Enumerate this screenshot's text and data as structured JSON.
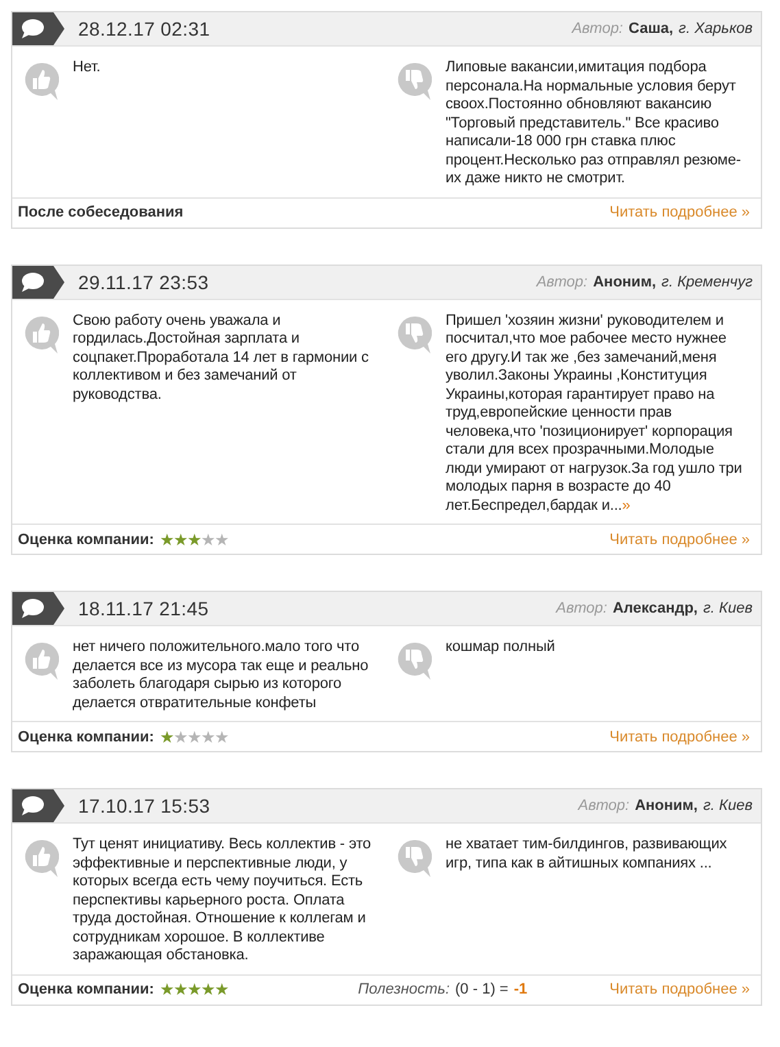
{
  "reviews": [
    {
      "date": "28.12.17 02:31",
      "author_label": "Автор:",
      "author_name": "Саша,",
      "author_city": "г. Харьков",
      "pros": {
        "text": "Нет."
      },
      "cons": {
        "text": "Липовые вакансии,имитация подбора персонала.На нормальные условия берут своох.Постоянно обновляют вакансию \"Торговый представитель.\" Все красиво написали-18 000 грн ставка плюс процент.Несколько раз отправлял резюме-их даже никто не смотрит."
      },
      "footer": {
        "kind": "note",
        "text": "После собеседования"
      },
      "read_more": "Читать подробнее »"
    },
    {
      "date": "29.11.17 23:53",
      "author_label": "Автор:",
      "author_name": "Аноним,",
      "author_city": "г. Кременчуг",
      "pros": {
        "text": "Свою работу очень уважала и гордилась.Достойная зарплата и соцпакет.Проработала 14 лет в гармонии с коллективом и без замечаний от руководства."
      },
      "cons": {
        "text": "Пришел 'хозяин жизни' руководителем и посчитал,что мое рабочее место нужнее его другу.И так же ,без замечаний,меня уволил.Законы Украины ,Конституция Украины,которая гарантирует право на труд,европейские ценности прав человека,что 'позиционирует' корпорация стали для всех прозрачными.Молодые люди умирают от нагрузок.За год ушло три молодых парня в возрасте до 40 лет.Беспредел,бардак и...",
        "more_link": "»"
      },
      "footer": {
        "kind": "rating",
        "text": "Оценка компании:",
        "stars": 3
      },
      "read_more": "Читать подробнее »"
    },
    {
      "date": "18.11.17 21:45",
      "author_label": "Автор:",
      "author_name": "Александр,",
      "author_city": "г. Киев",
      "pros": {
        "text": "нет ничего положительного.мало того что делается все из мусора так еще и реально заболеть благодаря сырью из которого делается отвратительные конфеты"
      },
      "cons": {
        "text": "кошмар полный"
      },
      "footer": {
        "kind": "rating",
        "text": "Оценка компании:",
        "stars": 1
      },
      "read_more": "Читать подробнее »"
    },
    {
      "date": "17.10.17 15:53",
      "author_label": "Автор:",
      "author_name": "Аноним,",
      "author_city": "г. Киев",
      "pros": {
        "text": "Тут ценят инициативу. Весь коллектив - это эффективные и перспективные люди, у которых всегда есть чему поучиться. Есть перспективы карьерного роста. Оплата труда достойная. Отношение к коллегам и сотрудникам хорошое. В коллективе заражающая обстановка."
      },
      "cons": {
        "text": "не хватает тим-билдингов, развивающих игр, типа как в айтишных компаниях ..."
      },
      "footer": {
        "kind": "rating",
        "text": "Оценка компании:",
        "stars": 5
      },
      "usefulness": {
        "label": "Полезность:",
        "formula": "(0 - 1) =",
        "score": "-1"
      },
      "read_more": "Читать подробнее »"
    }
  ]
}
